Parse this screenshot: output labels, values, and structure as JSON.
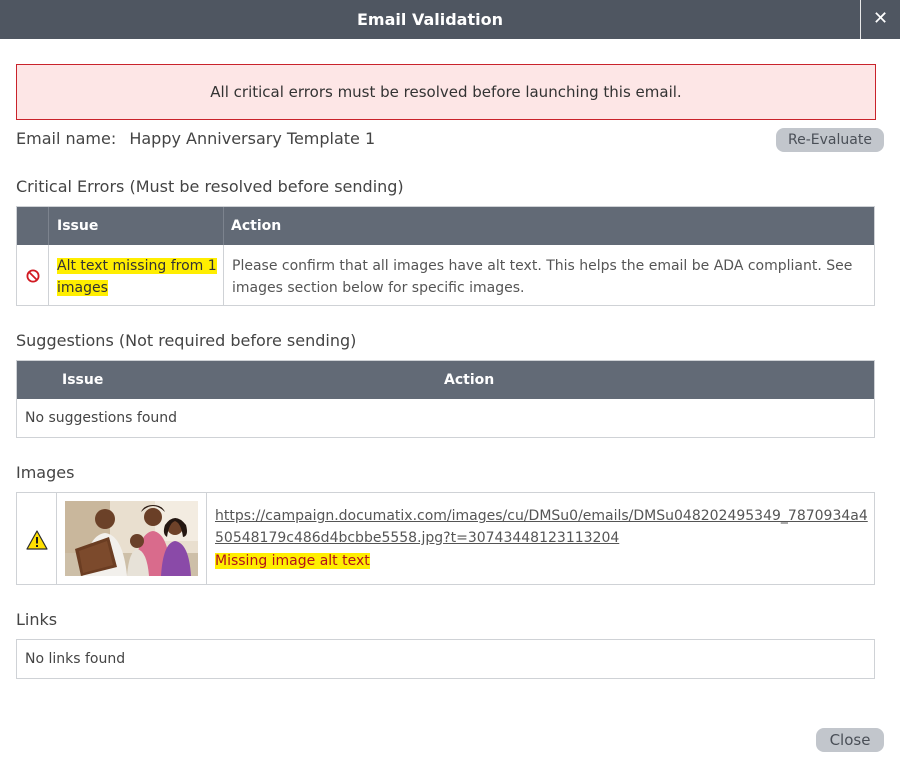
{
  "dialog": {
    "title": "Email Validation",
    "close_icon": "close-icon"
  },
  "alert": {
    "text": "All critical errors must be resolved before launching this email."
  },
  "email": {
    "label": "Email name:",
    "name": "Happy Anniversary Template 1",
    "reevaluate_label": "Re-Evaluate"
  },
  "critical": {
    "title": "Critical Errors (Must be resolved before sending)",
    "columns": [
      "Issue",
      "Action"
    ],
    "rows": [
      {
        "icon": "ban-icon",
        "issue": "Alt text missing from 1 images",
        "action": "Please confirm that all images have alt text. This helps the email be ADA compliant. See images section below for specific images."
      }
    ]
  },
  "suggestions": {
    "title": "Suggestions (Not required before sending)",
    "columns": [
      "Issue",
      "Action"
    ],
    "empty_text": "No suggestions found"
  },
  "images": {
    "title": "Images",
    "rows": [
      {
        "icon": "warning-icon",
        "url": "https://campaign.documatix.com/images/cu/DMSu0/emails/DMSu048202495349_7870934a450548179c486d4bcbbe5558.jpg?t=30743448123113204",
        "status": "Missing image alt text"
      }
    ]
  },
  "links": {
    "title": "Links",
    "empty_text": "No links found"
  },
  "footer": {
    "close_label": "Close"
  },
  "colors": {
    "titlebar": "#4f5661",
    "table_header": "#626a76",
    "alert_bg": "#fde6e6",
    "alert_border": "#c9232b",
    "highlight": "#ffee00",
    "error_text": "#b2121c",
    "button_bg": "#c2c6cc"
  }
}
